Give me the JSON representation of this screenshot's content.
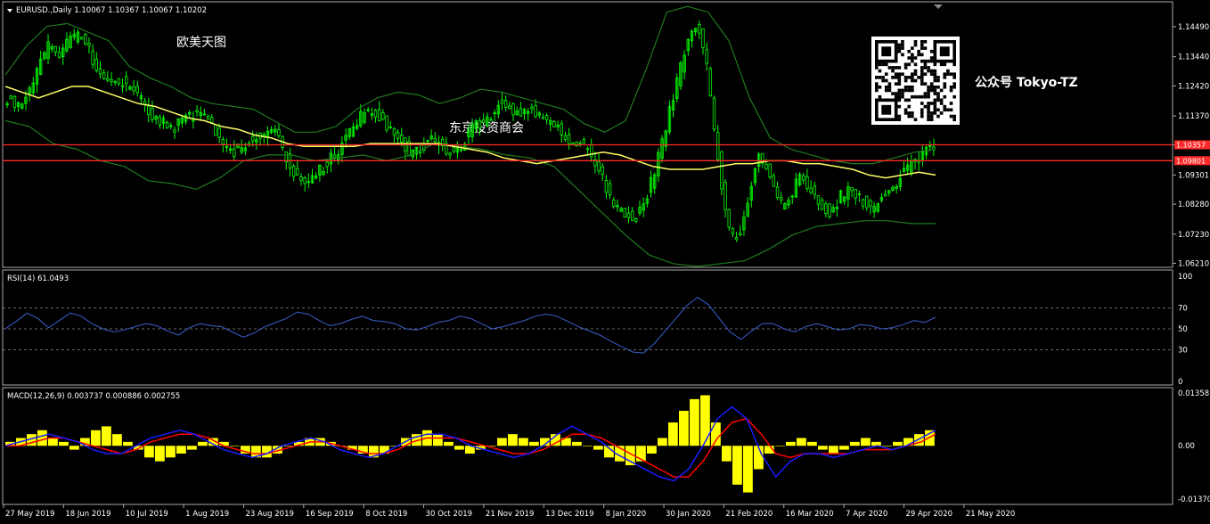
{
  "header": {
    "symbol_line": "EURUSD.,Daily  1.10067 1.10367 1.10067 1.10202",
    "overlay_title": "欧美天图",
    "overlay_center": "东京投资商会",
    "overlay_right": "公众号 Tokyo-TZ"
  },
  "colors": {
    "background": "#000000",
    "bull_candle": "#00ff00",
    "bbands": "#1f7a1f",
    "ma": "#ffff66",
    "hline": "#ff2a2a",
    "rsi": "#3a5fcd",
    "macd_hist": "#ffff00",
    "macd_line": "#1a1aff",
    "signal_line": "#ff0000"
  },
  "chart_data": [
    {
      "type": "candlestick",
      "title": "EURUSD.,Daily",
      "ylim": [
        1.061,
        1.153
      ],
      "yticks": [
        "1.14490",
        "1.13440",
        "1.12420",
        "1.11370",
        "1.10357",
        "1.09301",
        "1.08280",
        "1.07230",
        "1.06210"
      ],
      "hlines": [
        1.10357,
        1.09801
      ],
      "hline_labels": [
        "1.10357",
        "1.09801"
      ],
      "xticks": [
        "27 May 2019",
        "18 Jun 2019",
        "10 Jul 2019",
        "1 Aug 2019",
        "23 Aug 2019",
        "16 Sep 2019",
        "8 Oct 2019",
        "30 Oct 2019",
        "21 Nov 2019",
        "13 Dec 2019",
        "8 Jan 2020",
        "30 Jan 2020",
        "21 Feb 2020",
        "16 Mar 2020",
        "7 Apr 2020",
        "29 Apr 2020",
        "21 May 2020"
      ],
      "close_path": [
        1.12,
        1.118,
        1.122,
        1.13,
        1.138,
        1.134,
        1.14,
        1.142,
        1.136,
        1.128,
        1.125,
        1.126,
        1.124,
        1.119,
        1.113,
        1.112,
        1.109,
        1.112,
        1.114,
        1.116,
        1.11,
        1.103,
        1.101,
        1.104,
        1.106,
        1.108,
        1.108,
        1.1,
        1.093,
        1.09,
        1.094,
        1.097,
        1.101,
        1.107,
        1.112,
        1.116,
        1.114,
        1.11,
        1.107,
        1.101,
        1.102,
        1.105,
        1.105,
        1.101,
        1.103,
        1.109,
        1.111,
        1.113,
        1.12,
        1.115,
        1.115,
        1.117,
        1.112,
        1.11,
        1.108,
        1.103,
        1.104,
        1.098,
        1.09,
        1.083,
        1.08,
        1.078,
        1.084,
        1.096,
        1.11,
        1.125,
        1.138,
        1.146,
        1.13,
        1.1,
        1.075,
        1.07,
        1.085,
        1.1,
        1.095,
        1.082,
        1.085,
        1.093,
        1.088,
        1.082,
        1.08,
        1.086,
        1.088,
        1.084,
        1.081,
        1.085,
        1.087,
        1.094,
        1.097,
        1.101,
        1.102
      ],
      "ma_path": [
        1.124,
        1.122,
        1.12,
        1.122,
        1.124,
        1.124,
        1.122,
        1.12,
        1.118,
        1.117,
        1.115,
        1.113,
        1.112,
        1.11,
        1.109,
        1.107,
        1.106,
        1.104,
        1.103,
        1.103,
        1.103,
        1.103,
        1.104,
        1.104,
        1.104,
        1.104,
        1.104,
        1.103,
        1.102,
        1.101,
        1.099,
        1.098,
        1.097,
        1.098,
        1.099,
        1.1,
        1.101,
        1.1,
        1.098,
        1.096,
        1.095,
        1.095,
        1.095,
        1.096,
        1.097,
        1.097,
        1.098,
        1.098,
        1.097,
        1.097,
        1.096,
        1.095,
        1.093,
        1.092,
        1.093,
        1.094,
        1.093
      ],
      "bb_upper_path": [
        1.128,
        1.138,
        1.145,
        1.146,
        1.143,
        1.14,
        1.131,
        1.127,
        1.124,
        1.12,
        1.118,
        1.117,
        1.116,
        1.112,
        1.108,
        1.108,
        1.11,
        1.116,
        1.12,
        1.122,
        1.121,
        1.118,
        1.12,
        1.123,
        1.122,
        1.12,
        1.118,
        1.116,
        1.111,
        1.108,
        1.112,
        1.13,
        1.15,
        1.152,
        1.15,
        1.14,
        1.12,
        1.106,
        1.102,
        1.1,
        1.098,
        1.097,
        1.097,
        1.099,
        1.101,
        1.102
      ],
      "bb_lower_path": [
        1.112,
        1.11,
        1.104,
        1.102,
        1.098,
        1.096,
        1.091,
        1.09,
        1.088,
        1.092,
        1.098,
        1.1,
        1.1,
        1.098,
        1.099,
        1.1,
        1.098,
        1.1,
        1.104,
        1.103,
        1.102,
        1.1,
        1.099,
        1.096,
        1.088,
        1.08,
        1.072,
        1.065,
        1.062,
        1.061,
        1.062,
        1.063,
        1.067,
        1.072,
        1.075,
        1.076,
        1.077,
        1.077,
        1.076,
        1.076
      ]
    },
    {
      "type": "line",
      "title": "RSI(14) 61.0493",
      "ylim": [
        0,
        100
      ],
      "yticks": [
        "100",
        "70",
        "50",
        "30",
        "0"
      ],
      "levels": [
        70,
        50,
        30
      ],
      "values": [
        50,
        57,
        65,
        60,
        51,
        58,
        65,
        62,
        55,
        50,
        47,
        49,
        52,
        55,
        53,
        48,
        44,
        51,
        55,
        53,
        52,
        47,
        42,
        46,
        52,
        56,
        60,
        66,
        64,
        58,
        53,
        55,
        59,
        62,
        58,
        57,
        55,
        50,
        49,
        52,
        56,
        58,
        62,
        60,
        55,
        50,
        52,
        55,
        58,
        62,
        64,
        62,
        57,
        52,
        48,
        44,
        38,
        33,
        28,
        27,
        36,
        48,
        60,
        72,
        80,
        73,
        60,
        47,
        40,
        48,
        55,
        55,
        50,
        47,
        52,
        55,
        52,
        49,
        50,
        54,
        53,
        50,
        51,
        54,
        58,
        56,
        61
      ]
    },
    {
      "type": "bar+line",
      "title": "MACD(12,26,9) 0.003737 0.000886 0.002755",
      "ylim": [
        -0.0137,
        0.01358
      ],
      "yticks": [
        "0.013581",
        "0.00",
        "-0.013702"
      ],
      "histogram": [
        0.001,
        0.002,
        0.003,
        0.004,
        0.002,
        0.001,
        -0.001,
        0.002,
        0.004,
        0.005,
        0.003,
        0.001,
        -0.001,
        -0.003,
        -0.004,
        -0.003,
        -0.002,
        -0.001,
        0.001,
        0.002,
        0.001,
        0.0,
        -0.002,
        -0.003,
        -0.003,
        -0.002,
        0.0,
        0.001,
        0.002,
        0.002,
        0.001,
        0.0,
        -0.001,
        -0.002,
        -0.003,
        -0.002,
        0.0,
        0.002,
        0.003,
        0.004,
        0.003,
        0.001,
        -0.001,
        -0.002,
        -0.001,
        0.0,
        0.002,
        0.003,
        0.002,
        0.001,
        0.002,
        0.003,
        0.002,
        0.001,
        0.0,
        -0.001,
        -0.003,
        -0.004,
        -0.005,
        -0.004,
        -0.002,
        0.002,
        0.006,
        0.009,
        0.012,
        0.013,
        0.006,
        -0.004,
        -0.01,
        -0.012,
        -0.006,
        -0.002,
        0.0,
        0.001,
        0.002,
        0.001,
        -0.001,
        -0.002,
        -0.001,
        0.001,
        0.002,
        0.001,
        0.0,
        0.001,
        0.002,
        0.003,
        0.004
      ],
      "macd_line": [
        0.0,
        0.001,
        0.002,
        0.003,
        0.002,
        0.001,
        -0.001,
        -0.002,
        -0.002,
        0.0,
        0.002,
        0.003,
        0.004,
        0.003,
        0.001,
        -0.001,
        -0.002,
        -0.003,
        -0.002,
        0.0,
        0.001,
        0.002,
        0.001,
        -0.001,
        -0.002,
        -0.003,
        -0.002,
        0.0,
        0.002,
        0.003,
        0.003,
        0.002,
        0.0,
        -0.001,
        -0.002,
        -0.003,
        -0.002,
        0.0,
        0.003,
        0.005,
        0.003,
        0.001,
        -0.002,
        -0.004,
        -0.006,
        -0.008,
        -0.009,
        -0.006,
        0.0,
        0.007,
        0.01,
        0.007,
        -0.002,
        -0.008,
        -0.004,
        -0.002,
        -0.002,
        -0.003,
        -0.002,
        -0.001,
        0.0,
        -0.001,
        0.0,
        0.002,
        0.004
      ],
      "signal_line": [
        0.0,
        0.0,
        0.001,
        0.002,
        0.002,
        0.001,
        0.0,
        -0.001,
        -0.002,
        -0.001,
        0.001,
        0.002,
        0.003,
        0.003,
        0.002,
        0.0,
        -0.001,
        -0.002,
        -0.002,
        -0.001,
        0.0,
        0.001,
        0.001,
        0.0,
        -0.001,
        -0.002,
        -0.002,
        -0.001,
        0.001,
        0.002,
        0.002,
        0.002,
        0.001,
        0.0,
        -0.001,
        -0.002,
        -0.002,
        -0.001,
        0.001,
        0.003,
        0.003,
        0.002,
        0.0,
        -0.002,
        -0.004,
        -0.006,
        -0.008,
        -0.008,
        -0.004,
        0.002,
        0.006,
        0.007,
        0.003,
        -0.002,
        -0.003,
        -0.002,
        -0.002,
        -0.002,
        -0.002,
        -0.001,
        -0.001,
        -0.001,
        0.0,
        0.001,
        0.003
      ]
    }
  ]
}
